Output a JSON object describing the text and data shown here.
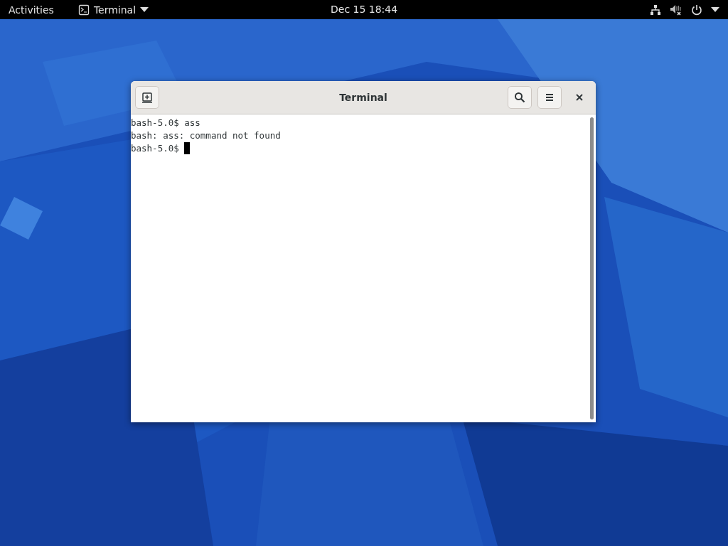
{
  "top_bar": {
    "activities": "Activities",
    "app_menu": {
      "label": "Terminal"
    },
    "clock": "Dec 15  18:44"
  },
  "window": {
    "title": "Terminal",
    "lines": [
      "bash-5.0$ ass",
      "bash: ass: command not found",
      "bash-5.0$ "
    ],
    "cursor": true
  }
}
